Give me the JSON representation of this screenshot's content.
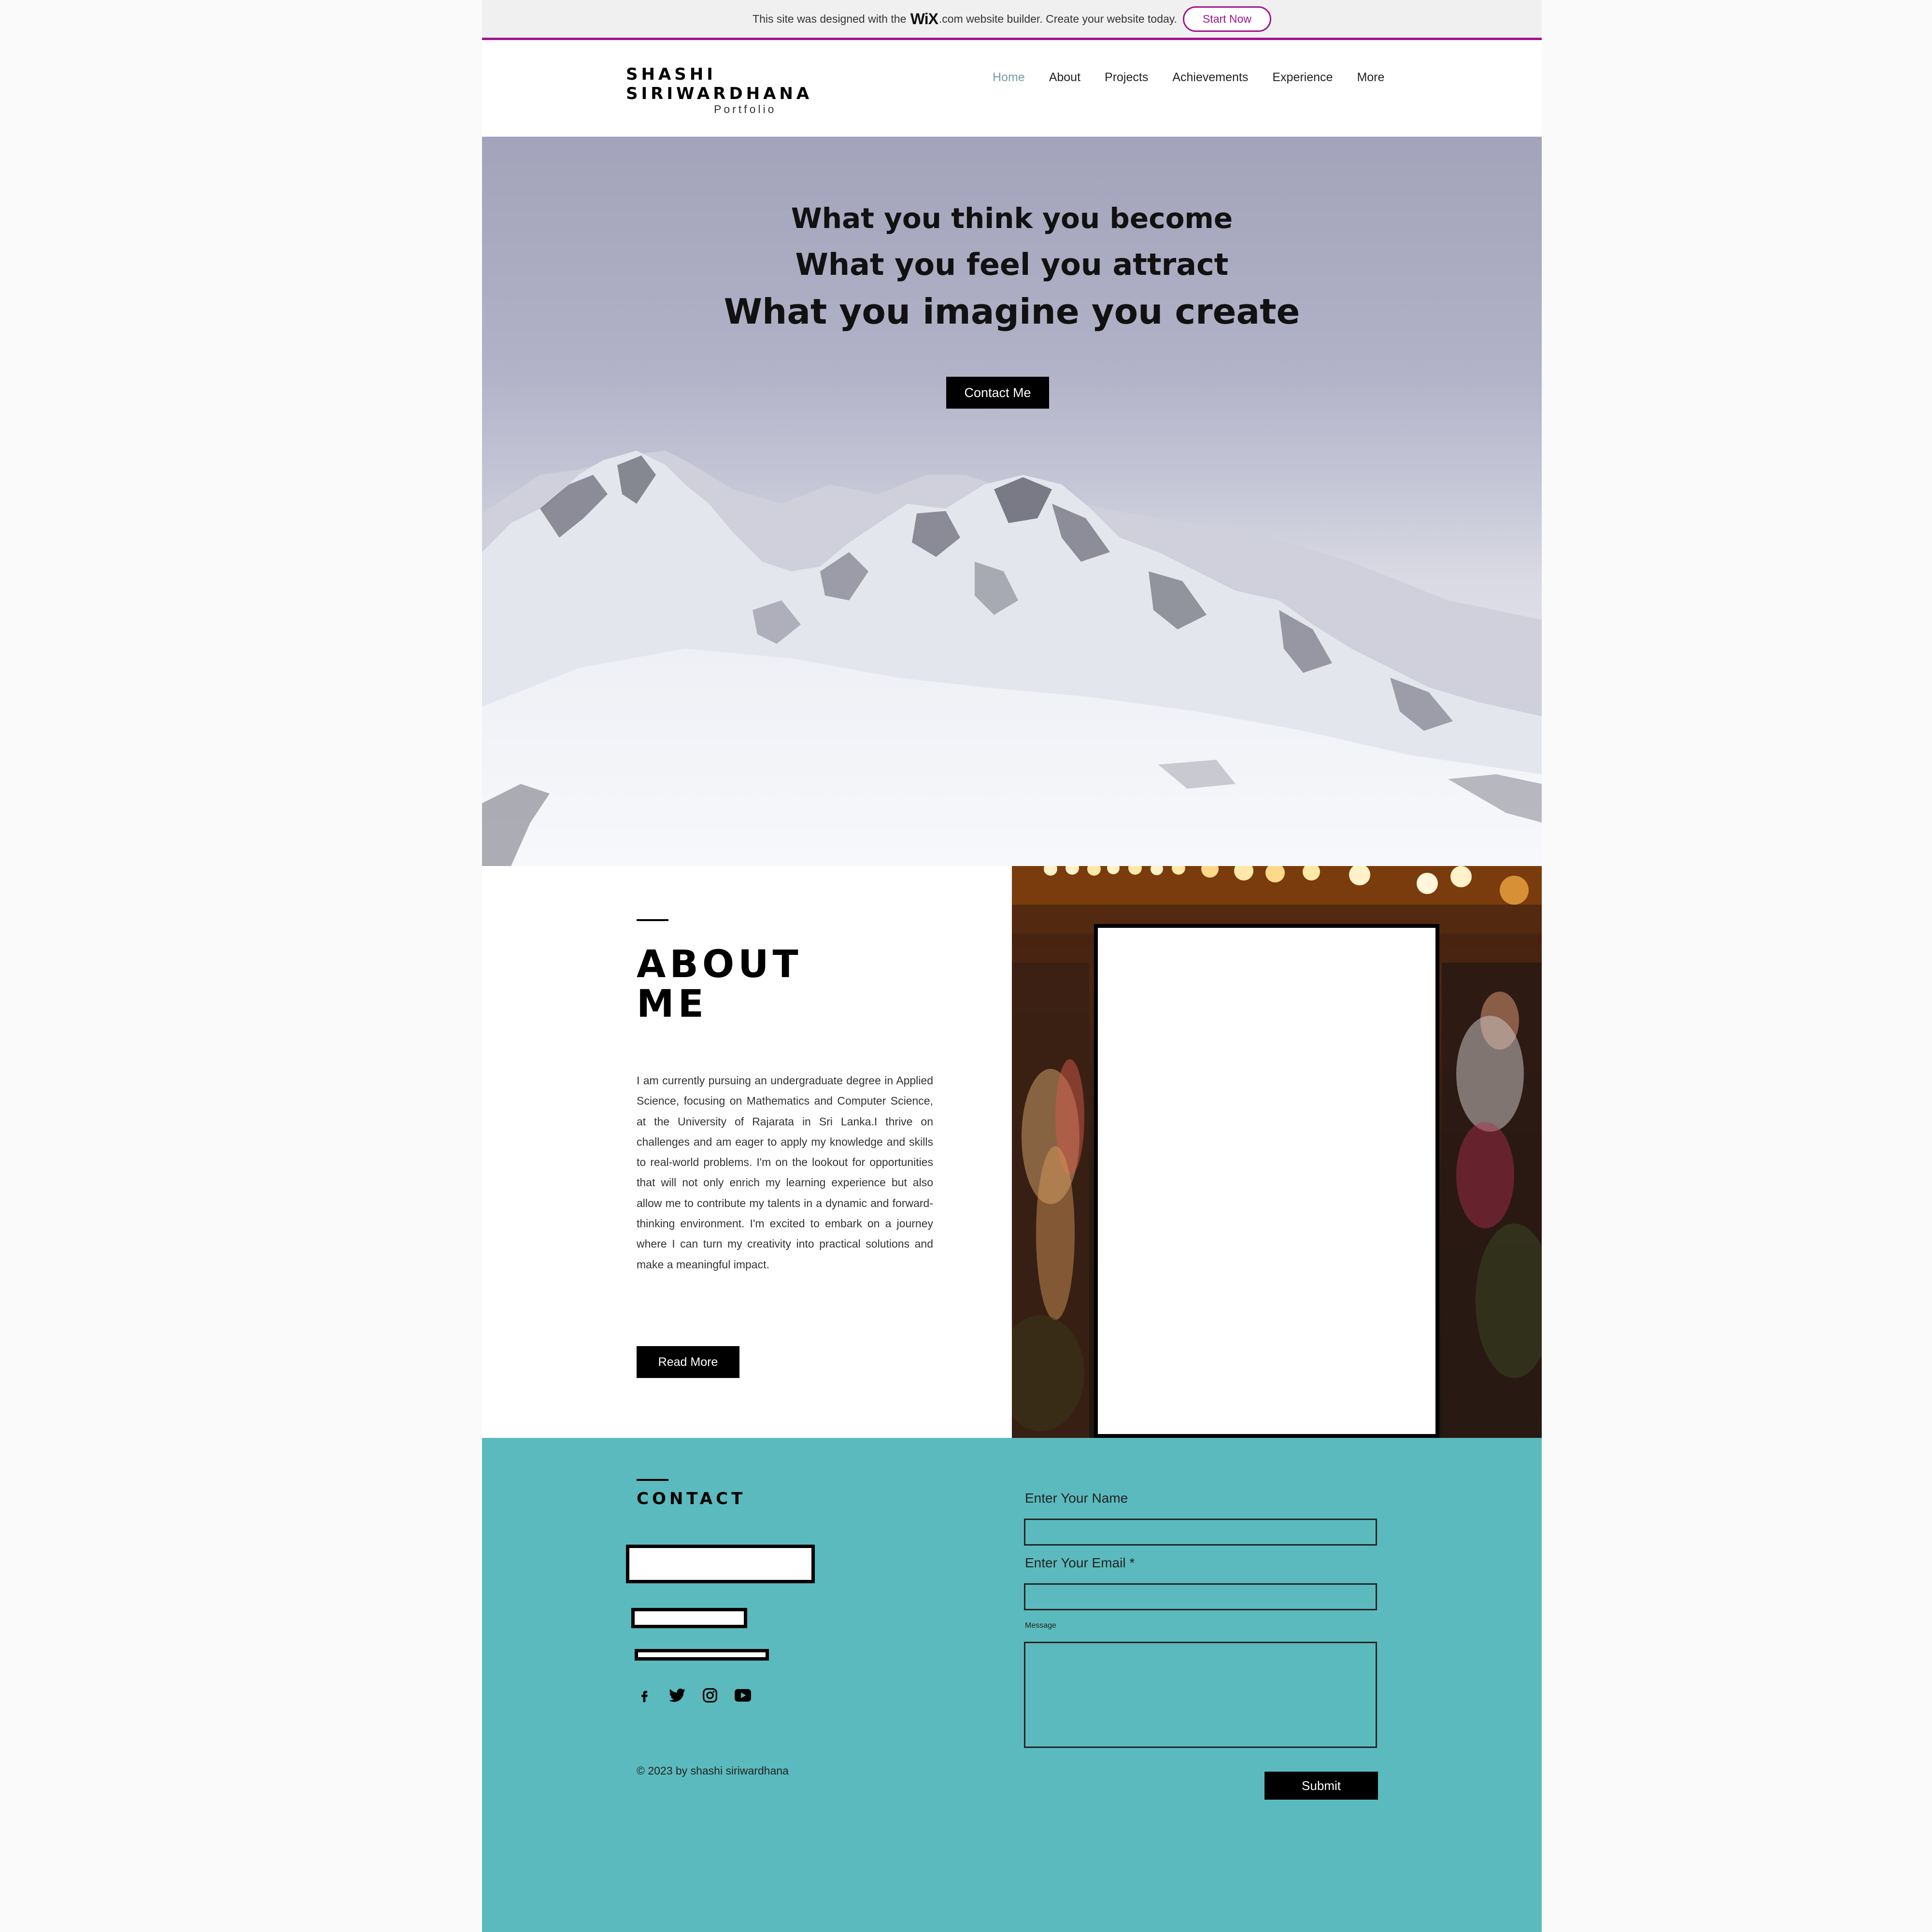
{
  "wix_banner": {
    "text_before": "This site was designed with the",
    "logo": "WiX",
    "text_after": ".com website builder. Create your website today.",
    "button_label": "Start Now",
    "accent_color": "#a0138e"
  },
  "header": {
    "brand_name": "SHASHI SIRIWARDHANA",
    "brand_tagline": "Portfolio",
    "nav": [
      {
        "label": "Home",
        "active": true
      },
      {
        "label": "About"
      },
      {
        "label": "Projects"
      },
      {
        "label": "Achievements"
      },
      {
        "label": "Experience"
      },
      {
        "label": "More"
      }
    ],
    "active_color": "#7a9aa6"
  },
  "hero": {
    "quote_lines": [
      "What you think you become",
      "What you feel you attract",
      "What you imagine you create"
    ],
    "button_label": "Contact Me"
  },
  "about": {
    "title_line1": "ABOUT",
    "title_line2": "ME",
    "body": "I am currently pursuing an undergraduate degree in Applied Science, focusing on Mathematics and Computer Science, at the University of Rajarata in Sri Lanka.I thrive on challenges and am eager to apply my knowledge and skills to real-world problems. I'm on the lookout for opportunities that will not only enrich my learning experience but also allow me to contribute my talents in a dynamic and forward-thinking environment. I'm excited to embark on a journey where I can turn my creativity into practical solutions and make a meaningful impact.",
    "button_label": "Read More"
  },
  "contact": {
    "title": "CONTACT",
    "social_icons": [
      "facebook-icon",
      "twitter-icon",
      "instagram-icon",
      "youtube-icon"
    ],
    "copyright": "© 2023 by shashi siriwardhana",
    "form": {
      "name_label": "Enter Your Name",
      "email_label": "Enter Your Email *",
      "message_label": "Message",
      "name_value": "",
      "email_value": "",
      "message_value": "",
      "submit_label": "Submit"
    },
    "background_color": "#5bbabd"
  }
}
